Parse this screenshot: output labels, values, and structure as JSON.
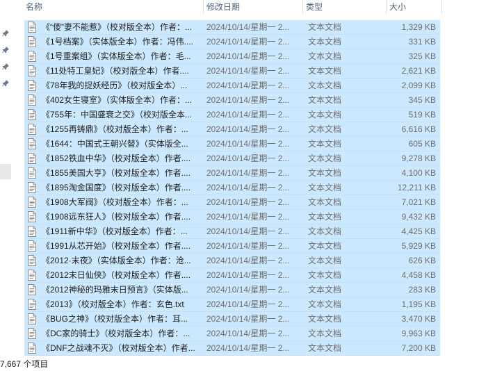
{
  "columns": {
    "name": "名称",
    "date": "修改日期",
    "type": "类型",
    "size": "大小"
  },
  "files": [
    {
      "name": "《“傻”妻不能惹》（校对版全本）作者：...",
      "date": "2024/10/14/星期一 2...",
      "type": "文本文档",
      "size": "1,329 KB"
    },
    {
      "name": "《1号档案》（实体版全本）作者：冯伟....",
      "date": "2024/10/14/星期一 2...",
      "type": "文本文档",
      "size": "331 KB"
    },
    {
      "name": "《1号重案组》（实体版全本）作者：毛...",
      "date": "2024/10/14/星期一 2...",
      "type": "文本文档",
      "size": "325 KB"
    },
    {
      "name": "《11处特工皇妃》（校对版全本）作者....",
      "date": "2024/10/14/星期一 2...",
      "type": "文本文档",
      "size": "2,621 KB"
    },
    {
      "name": "《78年我的捉妖经历》（校对版全本）...",
      "date": "2024/10/14/星期一 2...",
      "type": "文本文档",
      "size": "2,099 KB"
    },
    {
      "name": "《402女生寝室》（实体版全本）作者：...",
      "date": "2024/10/14/星期一 2...",
      "type": "文本文档",
      "size": "345 KB"
    },
    {
      "name": "《755年：中国盛衰之交》（校对版全本...",
      "date": "2024/10/14/星期一 2...",
      "type": "文本文档",
      "size": "519 KB"
    },
    {
      "name": "《1255再铸鼎》（校对版全本）作者：...",
      "date": "2024/10/14/星期一 2...",
      "type": "文本文档",
      "size": "6,616 KB"
    },
    {
      "name": "《1644：中国式王朝兴替》（实体版全...",
      "date": "2024/10/14/星期一 2...",
      "type": "文本文档",
      "size": "605 KB"
    },
    {
      "name": "《1852铁血中华》（校对版全本）作者....",
      "date": "2024/10/14/星期一 2...",
      "type": "文本文档",
      "size": "9,278 KB"
    },
    {
      "name": "《1855美国大亨》（校对版全本）作者....",
      "date": "2024/10/14/星期一 2...",
      "type": "文本文档",
      "size": "4,100 KB"
    },
    {
      "name": "《1895淘金国度》（校对版全本）作者....",
      "date": "2024/10/14/星期一 2...",
      "type": "文本文档",
      "size": "12,211 KB"
    },
    {
      "name": "《1908大军阀》（校对版全本）作者：...",
      "date": "2024/10/14/星期一 2...",
      "type": "文本文档",
      "size": "7,021 KB"
    },
    {
      "name": "《1908远东狂人》（校对版全本）作者....",
      "date": "2024/10/14/星期一 2...",
      "type": "文本文档",
      "size": "9,432 KB"
    },
    {
      "name": "《1911新中华》（校对版全本）作者：...",
      "date": "2024/10/14/星期一 2...",
      "type": "文本文档",
      "size": "4,425 KB"
    },
    {
      "name": "《1991从芯开始》（校对版全本）作者....",
      "date": "2024/10/14/星期一 2...",
      "type": "文本文档",
      "size": "5,929 KB"
    },
    {
      "name": "《2012·末夜》（实体版全本）作者：沧...",
      "date": "2024/10/14/星期一 2...",
      "type": "文本文档",
      "size": "626 KB"
    },
    {
      "name": "《2012末日仙侠》（校对版全本）作者....",
      "date": "2024/10/14/星期一 2...",
      "type": "文本文档",
      "size": "4,458 KB"
    },
    {
      "name": "《2012神秘的玛雅末日预言》（实体版...",
      "date": "2024/10/14/星期一 2...",
      "type": "文本文档",
      "size": "283 KB"
    },
    {
      "name": "《2013》（校对版全本）作者：玄色.txt",
      "date": "2024/10/14/星期一 2...",
      "type": "文本文档",
      "size": "1,195 KB"
    },
    {
      "name": "《BUG之神》（校对版全本）作者：耳...",
      "date": "2024/10/14/星期一 2...",
      "type": "文本文档",
      "size": "3,470 KB"
    },
    {
      "name": "《DC家的骑士》（校对版全本）作者：...",
      "date": "2024/10/14/星期一 2...",
      "type": "文本文档",
      "size": "9,963 KB"
    },
    {
      "name": "《DNF之战魂不灭》（校对版全本）作者...",
      "date": "2024/10/14/星期一 2...",
      "type": "文本文档",
      "size": "7,200 KB"
    }
  ],
  "status": {
    "text": "7,667 个项目"
  },
  "icons": {
    "pin": "pin-icon",
    "file": "text-file-icon"
  },
  "colors": {
    "selection": "#cce8ff",
    "header_text": "#4c607a",
    "secondary_text": "#6d6d6d"
  }
}
